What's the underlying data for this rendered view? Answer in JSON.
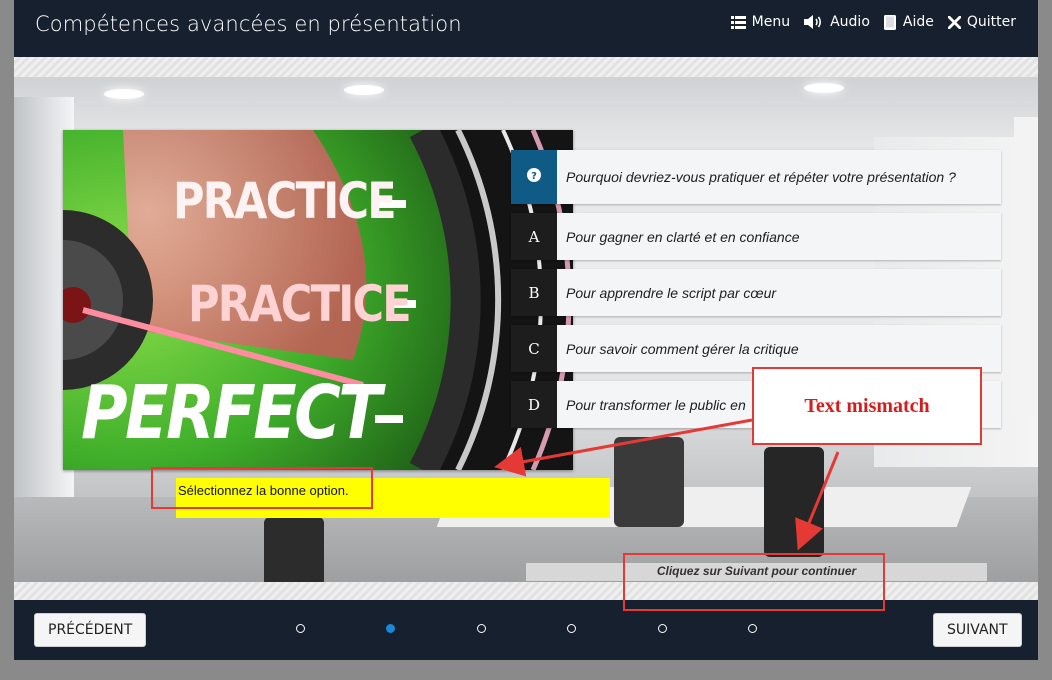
{
  "header": {
    "title": "Compétences avancées en présentation",
    "nav": [
      {
        "label": "Menu",
        "icon": "menu-icon"
      },
      {
        "label": "Audio",
        "icon": "speaker-icon"
      },
      {
        "label": "Aide",
        "icon": "help-book-icon"
      },
      {
        "label": "Quitter",
        "icon": "close-icon"
      }
    ]
  },
  "image": {
    "words": [
      "PRACTICE",
      "PRACTICE",
      "PERFECT"
    ]
  },
  "quiz": {
    "question": "Pourquoi devriez-vous pratiquer et répéter votre présentation ?",
    "question_icon": "question-icon",
    "options": [
      {
        "letter": "A",
        "text": "Pour gagner en clarté et en confiance"
      },
      {
        "letter": "B",
        "text": "Pour apprendre le script par cœur"
      },
      {
        "letter": "C",
        "text": "Pour savoir comment gérer la critique"
      },
      {
        "letter": "D",
        "text": "Pour transformer le public en"
      }
    ],
    "instruction": "Sélectionnez la bonne option.",
    "continue_hint": "Cliquez sur Suivant pour continuer"
  },
  "annotation": {
    "label": "Text mismatch",
    "color": "#e53935"
  },
  "footer": {
    "prev_label": "PRÉCÉDENT",
    "next_label": "SUIVANT",
    "page_count": 6,
    "current_page": 2
  },
  "colors": {
    "header_bg": "#17202e",
    "question_badge": "#0f5b86",
    "active_dot": "#1a88d8",
    "instruction_bg": "#ffff00"
  }
}
